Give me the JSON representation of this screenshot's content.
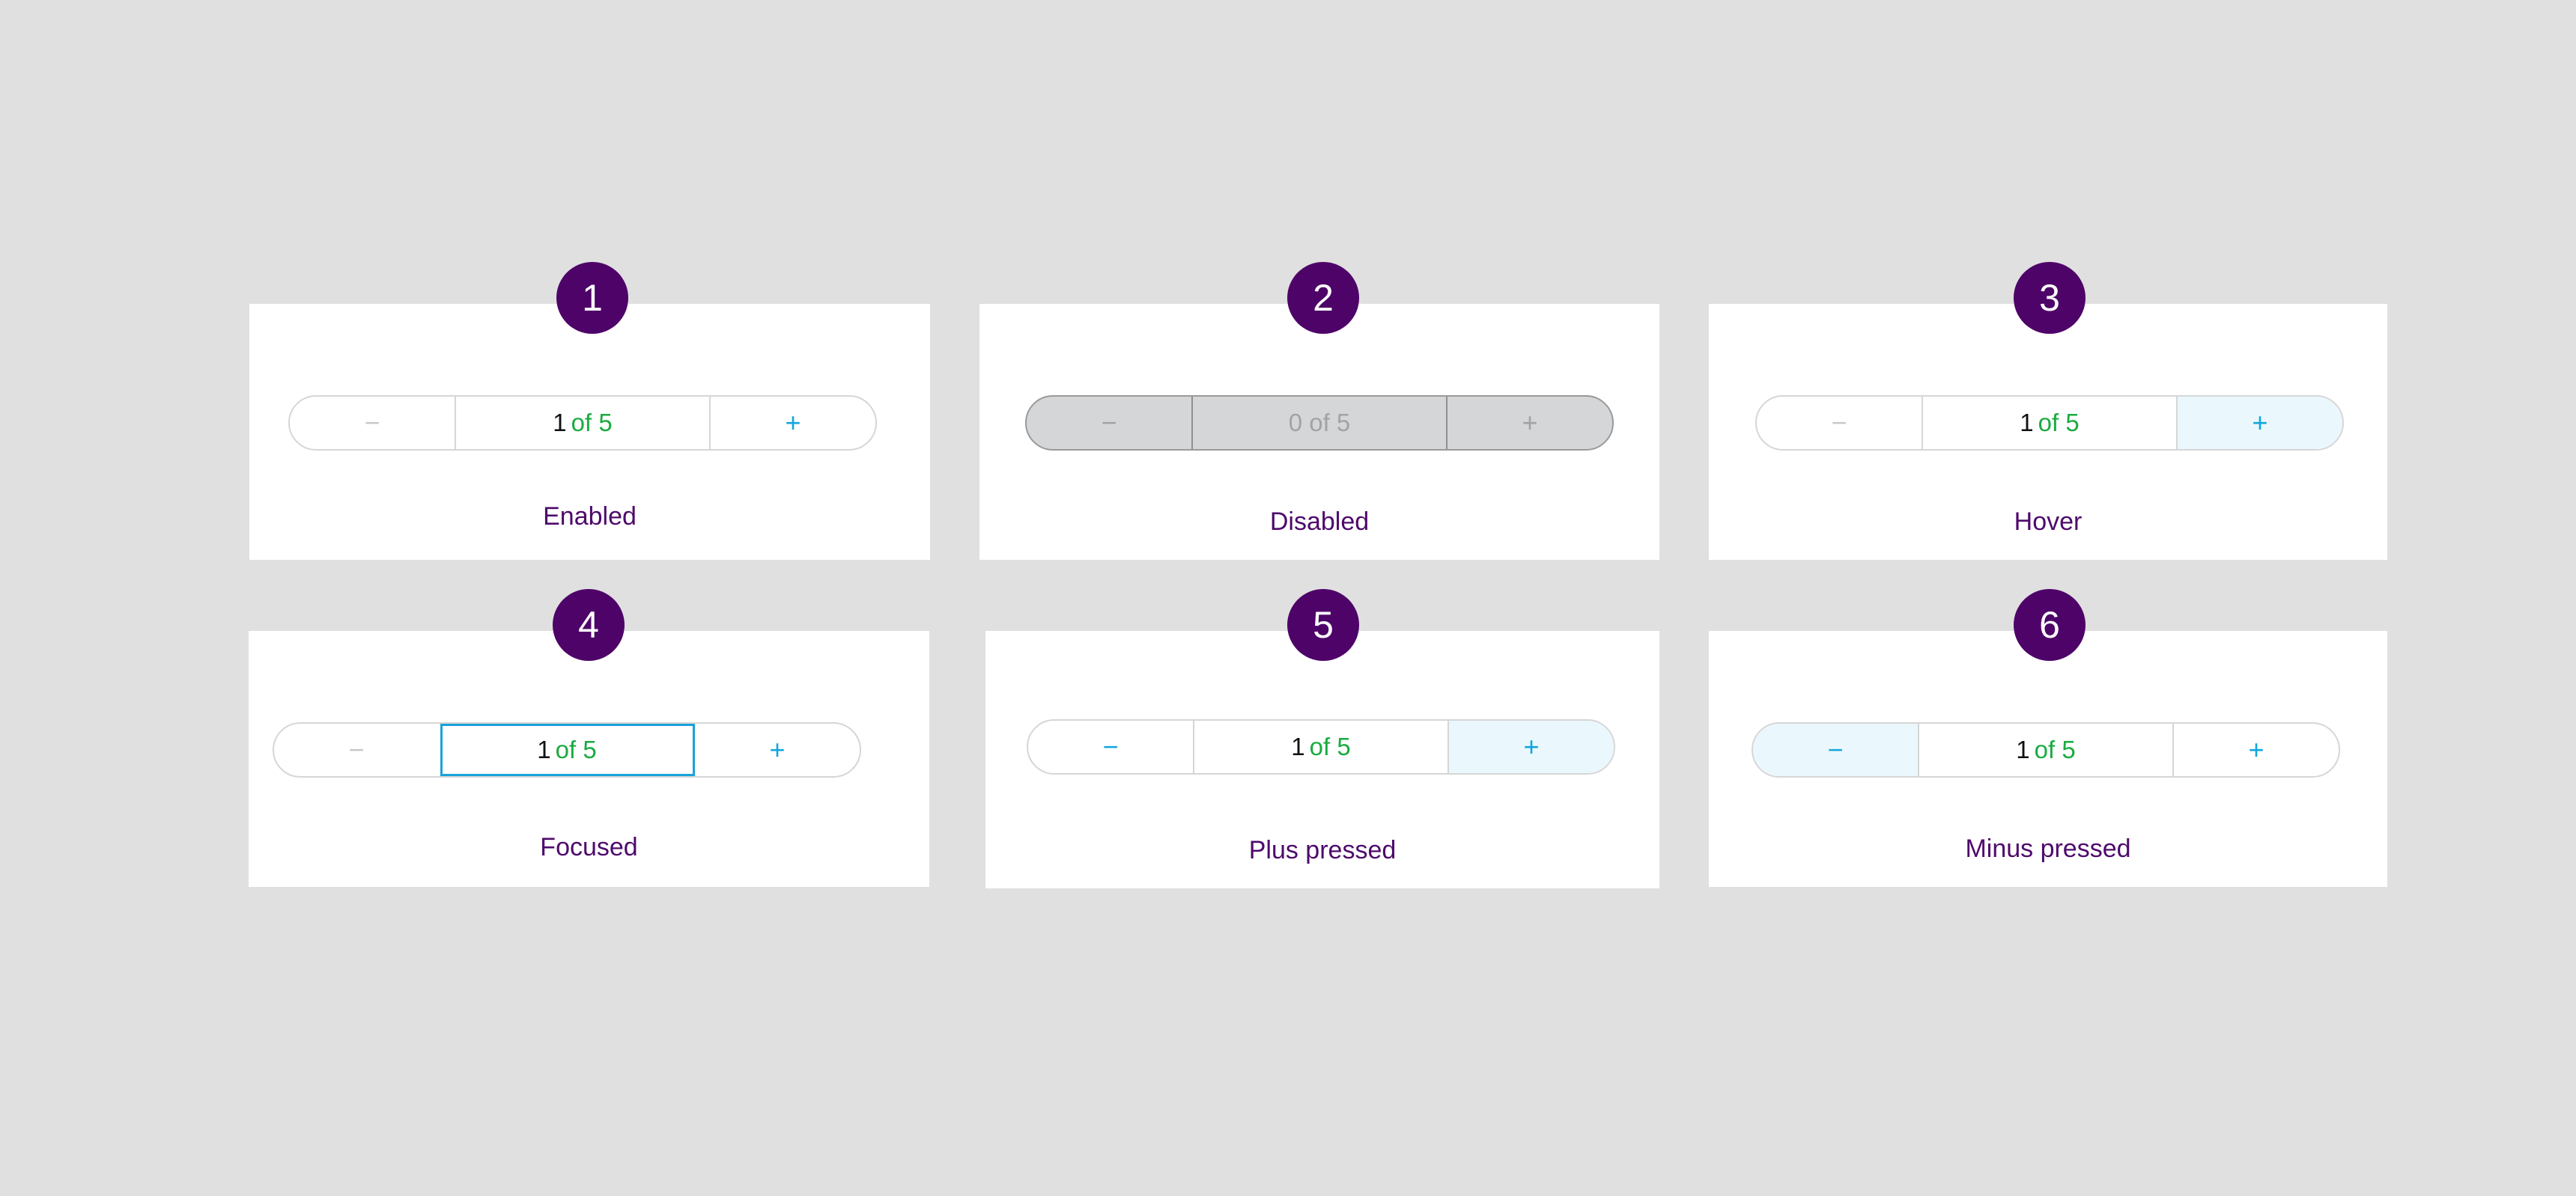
{
  "colors": {
    "background": "#e0e0e0",
    "card": "#ffffff",
    "badge": "#4e0368",
    "label": "#4e0a6b",
    "accent": "#11a6dc",
    "count_green": "#1aab40",
    "highlight": "#eaf8fd",
    "disabled_fill": "#d5d6d8"
  },
  "icons": {
    "minus": "−",
    "plus": "+"
  },
  "cards": [
    {
      "badge": "1",
      "state": "Enabled",
      "value": "1",
      "total_text": "of 5"
    },
    {
      "badge": "2",
      "state": "Disabled",
      "value_text": "0 of 5"
    },
    {
      "badge": "3",
      "state": "Hover",
      "value": "1",
      "total_text": "of 5"
    },
    {
      "badge": "4",
      "state": "Focused",
      "value": "1",
      "total_text": "of 5"
    },
    {
      "badge": "5",
      "state": "Plus pressed",
      "value": "1",
      "total_text": "of 5"
    },
    {
      "badge": "6",
      "state": "Minus pressed",
      "value": "1",
      "total_text": "of 5"
    }
  ]
}
